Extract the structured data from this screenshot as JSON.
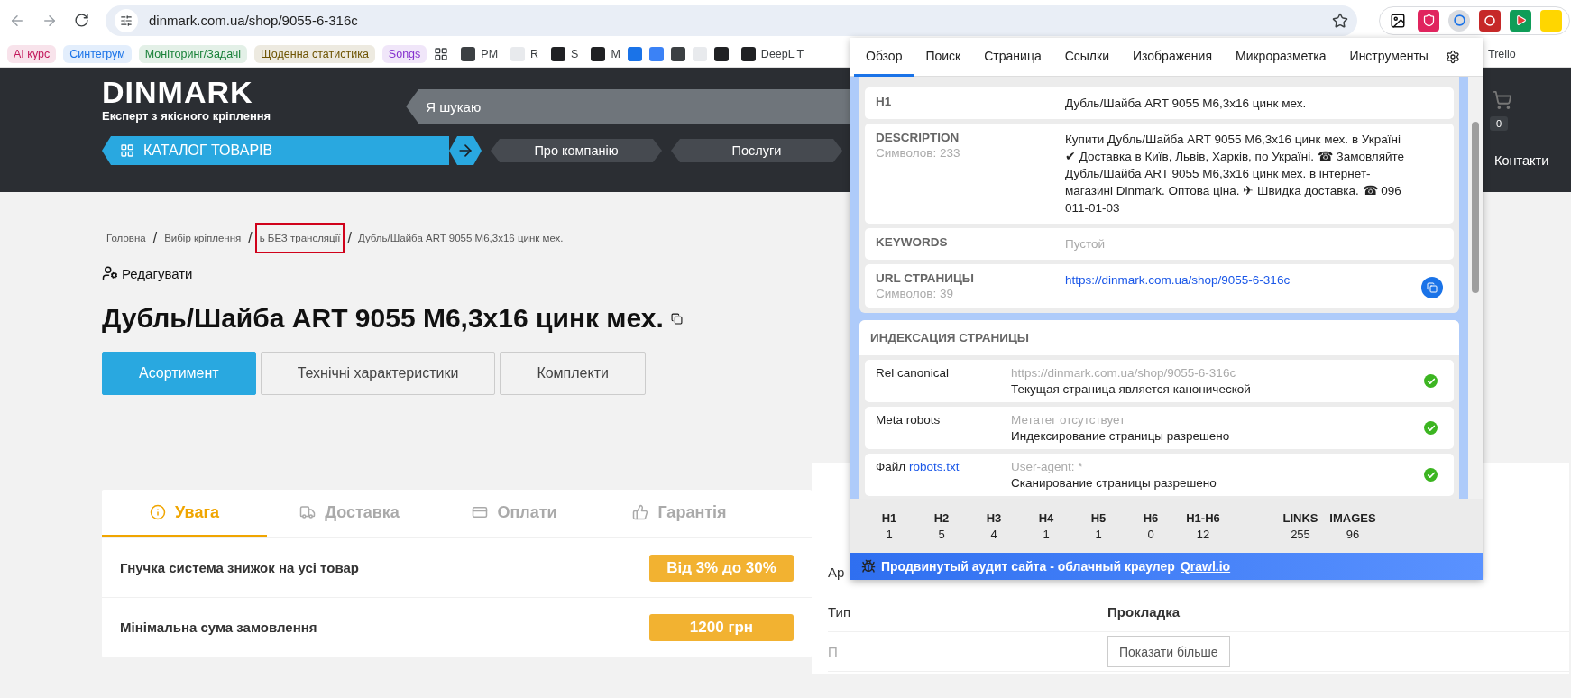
{
  "browser": {
    "url": "dinmark.com.ua/shop/9055-6-316c",
    "bookmarks": [
      {
        "kind": "group",
        "label": "AI курс",
        "color": "#c2185b"
      },
      {
        "kind": "group",
        "label": "Синтегрум",
        "color": "#1a73e8"
      },
      {
        "kind": "group",
        "label": "Моніторинг/Задачі",
        "color": "#188038"
      },
      {
        "kind": "group",
        "label": "Щоденна статистика",
        "color": "#6d5300"
      },
      {
        "kind": "group",
        "label": "Songs",
        "color": "#8430ce"
      },
      {
        "kind": "apps"
      },
      {
        "kind": "link",
        "label": "PM"
      },
      {
        "kind": "link",
        "label": "R"
      },
      {
        "kind": "link",
        "label": "S"
      },
      {
        "kind": "link",
        "label": "M"
      },
      {
        "kind": "icon"
      },
      {
        "kind": "icon"
      },
      {
        "kind": "icon"
      },
      {
        "kind": "icon"
      },
      {
        "kind": "icon"
      },
      {
        "kind": "link",
        "label": "DeepL T"
      }
    ],
    "bookmark_after_popup": "Trello"
  },
  "site": {
    "logo": "DINMARK",
    "tagline": "Експерт з якісного кріплення",
    "search_placeholder": "Я шукаю",
    "catalog": "КАТАЛОГ ТОВАРІВ",
    "nav": [
      "Про компанію",
      "Послуги"
    ],
    "nav_right": "Контакти",
    "cart_count": "0"
  },
  "page": {
    "breadcrumbs": [
      {
        "label": "Головна",
        "highlighted": false
      },
      {
        "label": "Вибір кріплення",
        "highlighted": false
      },
      {
        "label": "ь БЕЗ трансляції",
        "highlighted": true
      }
    ],
    "separator": "/",
    "breadcrumb_current": "Дубль/Шайба ART 9055 M6,3x16 цинк мех.",
    "edit": "Редагувати",
    "title": "Дубль/Шайба ART 9055 M6,3x16 цинк мех.",
    "tabs": [
      {
        "label": "Асортимент",
        "selected": true
      },
      {
        "label": "Технічні характеристики",
        "selected": false
      },
      {
        "label": "Комплекти",
        "selected": false
      }
    ],
    "info_tabs": [
      {
        "label": "Увага",
        "selected": true
      },
      {
        "label": "Доставка",
        "selected": false
      },
      {
        "label": "Оплати",
        "selected": false
      },
      {
        "label": "Гарантія",
        "selected": false
      }
    ],
    "info_rows": [
      {
        "label": "Гнучка система знижок на усі товар",
        "value": "Від 3% до 30%"
      },
      {
        "label": "Мінімальна сума замовлення",
        "value": "1200 грн"
      }
    ],
    "spec_rows": [
      {
        "label": "Ар"
      },
      {
        "label": "Тип",
        "value": "Прокладка"
      },
      {
        "label": "П"
      }
    ],
    "show_more": "Показати більше"
  },
  "popup": {
    "tabs": [
      {
        "label": "Обзор",
        "selected": true
      },
      {
        "label": "Поиск",
        "selected": false
      },
      {
        "label": "Страница",
        "selected": false
      },
      {
        "label": "Ссылки",
        "selected": false
      },
      {
        "label": "Изображения",
        "selected": false
      },
      {
        "label": "Микроразметка",
        "selected": false
      },
      {
        "label": "Инструменты",
        "selected": false
      }
    ],
    "meta": [
      {
        "label": "H1",
        "value": "Дубль/Шайба ART 9055 M6,3x16 цинк мех."
      },
      {
        "label": "DESCRIPTION",
        "sub": "Символов: 233",
        "value": "Купити Дубль/Шайба ART 9055 M6,3x16 цинк мех. в Україні ✔ Доставка в Київ, Львів, Харків, по Україні. ☎ Замовляйте Дубль/Шайба ART 9055 M6,3x16 цинк мех. в інтернет-магазині Dinmark. Оптова ціна. ✈ Швидка доставка. ☎ 096 011-01-03"
      },
      {
        "label": "KEYWORDS",
        "value": "Пустой",
        "empty": true
      },
      {
        "label": "URL СТРАНИЦЫ",
        "sub": "Символов: 39",
        "value": "https://dinmark.com.ua/shop/9055-6-316c",
        "link": true
      }
    ],
    "indexing": {
      "title": "ИНДЕКСАЦИЯ СТРАНИЦЫ",
      "rows": [
        {
          "label": "Rel canonical",
          "detail": "https://dinmark.com.ua/shop/9055-6-316c",
          "status": "Текущая страница является канонической",
          "ok": true
        },
        {
          "label": "Meta robots",
          "detail": "Метатег отсутствует",
          "status": "Индексирование страницы разрешено",
          "ok": true
        },
        {
          "label": "Файл",
          "link": "robots.txt",
          "detail": "User-agent: *",
          "status": "Сканирование страницы разрешено",
          "ok": true
        }
      ]
    },
    "stats": [
      {
        "label": "H1",
        "value": "1"
      },
      {
        "label": "H2",
        "value": "5"
      },
      {
        "label": "H3",
        "value": "4"
      },
      {
        "label": "H4",
        "value": "1"
      },
      {
        "label": "H5",
        "value": "1"
      },
      {
        "label": "H6",
        "value": "0"
      },
      {
        "label": "H1-H6",
        "value": "12"
      },
      {
        "label": "LINKS",
        "value": "255"
      },
      {
        "label": "IMAGES",
        "value": "96"
      }
    ],
    "footer": {
      "text": "Продвинутый аудит сайта - облачный краулер",
      "link": "Qrawl.io"
    }
  }
}
